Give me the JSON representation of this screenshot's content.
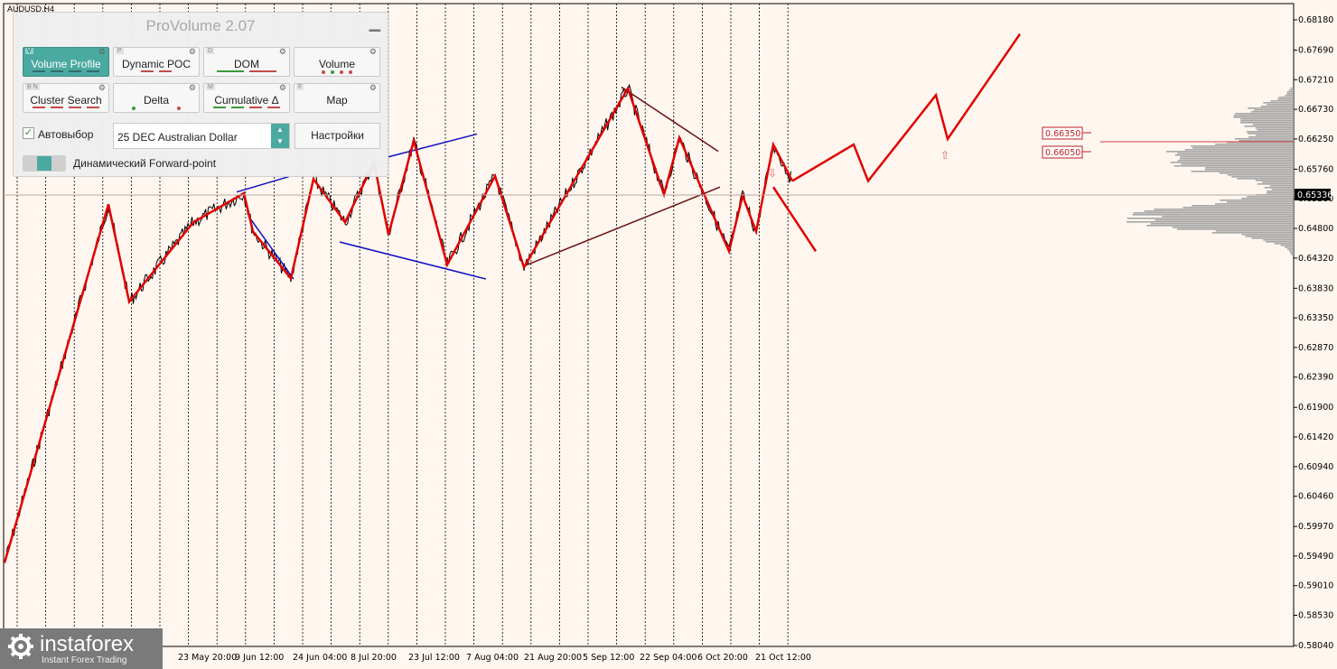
{
  "symbol": "AUDUSD,H4",
  "panel": {
    "title": "ProVolume 2.07",
    "buttons": [
      {
        "key": "V",
        "label": "Volume Profile",
        "active": true
      },
      {
        "key": "P",
        "label": "Dynamic POC",
        "active": false
      },
      {
        "key": "D",
        "label": "DOM",
        "active": false
      },
      {
        "key": "",
        "label": "Volume",
        "active": false
      },
      {
        "key": "B N",
        "label": "Cluster Search",
        "active": false
      },
      {
        "key": "",
        "label": "Delta",
        "active": false
      },
      {
        "key": "M",
        "label": "Cumulative Δ",
        "active": false
      },
      {
        "key": "F",
        "label": "Map",
        "active": false
      }
    ],
    "auto_select_label": "Автовыбор",
    "contract": "25 DEC Australian Dollar",
    "settings_label": "Настройки",
    "forward_point_label": "Динамический Forward-point"
  },
  "logo": {
    "brand": "instaforex",
    "tagline": "Instant Forex Trading"
  },
  "colors": {
    "background": "#fff6ef",
    "zigzag": "#e00000",
    "trendline_blue": "#1010c0",
    "trendline_brown": "#7a1010",
    "price": "#000000",
    "profile": "#a6a6a6",
    "level": "#c02020"
  },
  "chart_data": {
    "type": "line",
    "title": "",
    "xlabel": "",
    "ylabel": "",
    "ylim": [
      0.5804,
      0.6818
    ],
    "y_ticks": [
      "0.68180",
      "0.67690",
      "0.67210",
      "0.66730",
      "0.66250",
      "0.65760",
      "0.65280",
      "0.64800",
      "0.64320",
      "0.63830",
      "0.63350",
      "0.62870",
      "0.62390",
      "0.61900",
      "0.61420",
      "0.60940",
      "0.60460",
      "0.59970",
      "0.59490",
      "0.59010",
      "0.58530",
      "0.58040"
    ],
    "x_ticks": [
      "23 May 20:00",
      "9 Jun 12:00",
      "24 Jun 04:00",
      "8 Jul 20:00",
      "23 Jul 12:00",
      "7 Aug 04:00",
      "21 Aug 20:00",
      "5 Sep 12:00",
      "22 Sep 04:00",
      "6 Oct 20:00",
      "21 Oct 12:00"
    ],
    "current_price": "0.65336",
    "levels": [
      "0.66350",
      "0.66050"
    ],
    "grid": "vertical dotted",
    "zigzag": {
      "name": "",
      "points": [
        [
          0,
          0.5938
        ],
        [
          1,
          0.6519
        ],
        [
          2,
          0.6361
        ],
        [
          3,
          0.649
        ],
        [
          4,
          0.6537
        ],
        [
          5,
          0.6475
        ],
        [
          6,
          0.6399
        ],
        [
          7,
          0.656
        ],
        [
          8,
          0.649
        ],
        [
          9,
          0.6587
        ],
        [
          10,
          0.647
        ],
        [
          11,
          0.6622
        ],
        [
          12,
          0.6421
        ],
        [
          13,
          0.6565
        ],
        [
          14,
          0.6417
        ],
        [
          15,
          0.6707
        ],
        [
          16,
          0.6535
        ],
        [
          17,
          0.6627
        ],
        [
          18,
          0.6443
        ],
        [
          19,
          0.6533
        ],
        [
          20,
          0.6475
        ],
        [
          21,
          0.6616
        ],
        [
          22,
          0.6557
        ],
        [
          23,
          0.6696
        ],
        [
          24,
          0.6625
        ],
        [
          25,
          0.6795
        ],
        [
          26,
          0.6443
        ]
      ]
    },
    "trendlines": [
      {
        "color": "blue",
        "from": [
          0.6539,
          0.6573
        ],
        "to": [
          0.6564,
          0.6647
        ]
      },
      {
        "color": "blue",
        "from": [
          0.65,
          0.6434
        ],
        "to": [
          0.649,
          0.6398
        ]
      },
      {
        "color": "blue",
        "from": [
          0.6596,
          0.6627
        ],
        "to": [
          0.6633,
          0.6633
        ]
      },
      {
        "color": "blue",
        "from": [
          0.6458,
          0.6416
        ],
        "to": [
          0.6416,
          0.6398
        ]
      },
      {
        "color": "brown",
        "from": [
          0.6411,
          0.6419
        ],
        "to": [
          0.6547,
          0.6547
        ]
      },
      {
        "color": "brown",
        "from": [
          0.6709,
          0.6709
        ],
        "to": [
          0.6605,
          0.6605
        ]
      }
    ]
  }
}
